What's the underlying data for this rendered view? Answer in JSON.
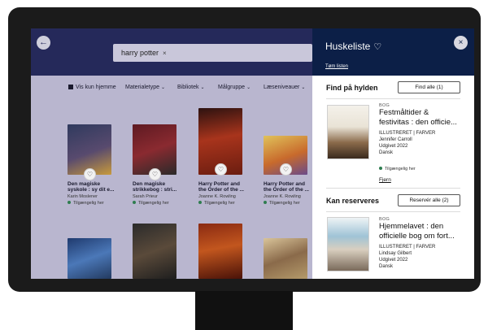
{
  "app": {
    "search": {
      "query": "harry potter",
      "clear": "×"
    },
    "back": "←",
    "filters": {
      "show_home": "Vis kun hjemme",
      "material_type": "Materialetype",
      "library": "Bibliotek",
      "target_group": "Målgruppe",
      "reading_level": "Læseniveauer"
    },
    "results": [
      {
        "title_1": "Den magiske",
        "title_2": "syskole : sy dit e...",
        "author": "Karin Moslener",
        "status": "Tilgængelig her",
        "cover_color": "#3b3a4f"
      },
      {
        "title_1": "Den magiske",
        "title_2": "strikkebog : stri...",
        "author": "Sarah Prieur",
        "status": "Tilgængelig her",
        "cover_color": "#6b2027"
      },
      {
        "title_1": "Harry Potter and",
        "title_2": "the Order of the ...",
        "author": "Joanne K. Rowling",
        "status": "Tilgængelig her",
        "cover_color": "#8e2a18"
      },
      {
        "title_1": "Harry Potter and",
        "title_2": "the Order of the ...",
        "author": "Joanne K. Rowling",
        "status": "Tilgængelig her",
        "cover_color": "#c8a43a"
      }
    ]
  },
  "panel": {
    "title": "Huskeliste",
    "clear_list": "Tøm listen",
    "close": "×",
    "on_shelf": {
      "heading": "Find på hylden",
      "button": "Find alle (1)",
      "item": {
        "type": "BOG",
        "title_1": "Festmåltider &",
        "title_2": "festivitas : den officie...",
        "format": "ILLUSTRERET | FARVER",
        "author": "Jennifer Carroll",
        "published": "Udgivet 2022",
        "language": "Dansk",
        "availability": "Tilgængelig her",
        "remove": "Fjern"
      }
    },
    "reservable": {
      "heading": "Kan reserveres",
      "button": "Reservér alle (2)",
      "item": {
        "type": "BOG",
        "title_1": "Hjemmelavet : den",
        "title_2": "officielle bog om fort...",
        "format": "ILLUSTRERET | FARVER",
        "author": "Lindsay Gilbert",
        "published": "Udgivet 2022",
        "language": "Dansk"
      }
    }
  }
}
